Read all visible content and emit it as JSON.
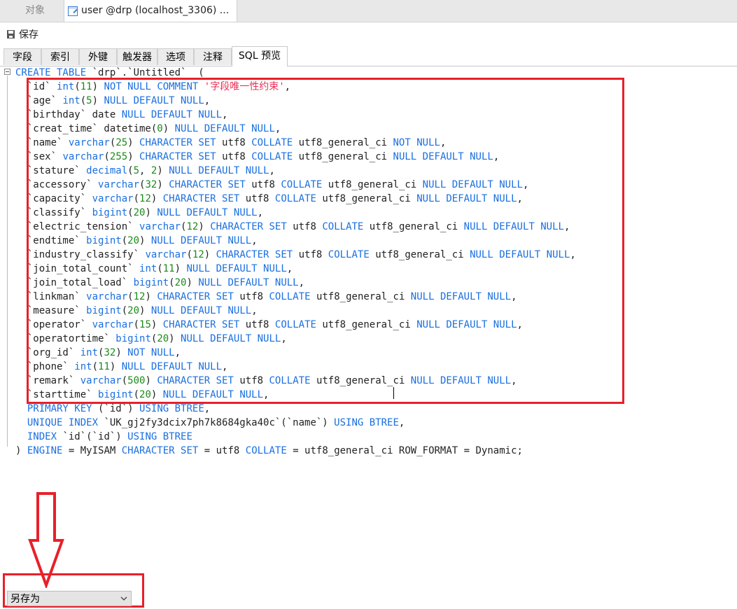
{
  "doc_tabs": {
    "objects_label": "对象",
    "active_label": "user @drp (localhost_3306) ..."
  },
  "toolbar": {
    "save_label": "保存"
  },
  "designer_tabs": [
    "字段",
    "索引",
    "外键",
    "触发器",
    "选项",
    "注释",
    "SQL 预览"
  ],
  "sql_lines": [
    [
      [
        "kw",
        "CREATE TABLE "
      ],
      [
        "txt",
        "`drp`.`Untitled`  ("
      ]
    ],
    [
      [
        "txt",
        "  `id` "
      ],
      [
        "kw",
        "int"
      ],
      [
        "txt",
        "("
      ],
      [
        "num",
        "11"
      ],
      [
        "txt",
        ") "
      ],
      [
        "kw",
        "NOT NULL COMMENT "
      ],
      [
        "str",
        "'字段唯一性约束'"
      ],
      [
        "txt",
        ","
      ]
    ],
    [
      [
        "txt",
        "  `age` "
      ],
      [
        "kw",
        "int"
      ],
      [
        "txt",
        "("
      ],
      [
        "num",
        "5"
      ],
      [
        "txt",
        ") "
      ],
      [
        "kw",
        "NULL DEFAULT NULL"
      ],
      [
        "txt",
        ","
      ]
    ],
    [
      [
        "txt",
        "  `birthday` date "
      ],
      [
        "kw",
        "NULL DEFAULT NULL"
      ],
      [
        "txt",
        ","
      ]
    ],
    [
      [
        "txt",
        "  `creat_time` datetime("
      ],
      [
        "num",
        "0"
      ],
      [
        "txt",
        ") "
      ],
      [
        "kw",
        "NULL DEFAULT NULL"
      ],
      [
        "txt",
        ","
      ]
    ],
    [
      [
        "txt",
        "  `name` "
      ],
      [
        "kw",
        "varchar"
      ],
      [
        "txt",
        "("
      ],
      [
        "num",
        "25"
      ],
      [
        "txt",
        ") "
      ],
      [
        "kw",
        "CHARACTER SET "
      ],
      [
        "txt",
        "utf8 "
      ],
      [
        "kw",
        "COLLATE "
      ],
      [
        "txt",
        "utf8_general_ci "
      ],
      [
        "kw",
        "NOT NULL"
      ],
      [
        "txt",
        ","
      ]
    ],
    [
      [
        "txt",
        "  `sex` "
      ],
      [
        "kw",
        "varchar"
      ],
      [
        "txt",
        "("
      ],
      [
        "num",
        "255"
      ],
      [
        "txt",
        ") "
      ],
      [
        "kw",
        "CHARACTER SET "
      ],
      [
        "txt",
        "utf8 "
      ],
      [
        "kw",
        "COLLATE "
      ],
      [
        "txt",
        "utf8_general_ci "
      ],
      [
        "kw",
        "NULL DEFAULT NULL"
      ],
      [
        "txt",
        ","
      ]
    ],
    [
      [
        "txt",
        "  `stature` "
      ],
      [
        "kw",
        "decimal"
      ],
      [
        "txt",
        "("
      ],
      [
        "num",
        "5"
      ],
      [
        "txt",
        ", "
      ],
      [
        "num",
        "2"
      ],
      [
        "txt",
        ") "
      ],
      [
        "kw",
        "NULL DEFAULT NULL"
      ],
      [
        "txt",
        ","
      ]
    ],
    [
      [
        "txt",
        "  `accessory` "
      ],
      [
        "kw",
        "varchar"
      ],
      [
        "txt",
        "("
      ],
      [
        "num",
        "32"
      ],
      [
        "txt",
        ") "
      ],
      [
        "kw",
        "CHARACTER SET "
      ],
      [
        "txt",
        "utf8 "
      ],
      [
        "kw",
        "COLLATE "
      ],
      [
        "txt",
        "utf8_general_ci "
      ],
      [
        "kw",
        "NULL DEFAULT NULL"
      ],
      [
        "txt",
        ","
      ]
    ],
    [
      [
        "txt",
        "  `capacity` "
      ],
      [
        "kw",
        "varchar"
      ],
      [
        "txt",
        "("
      ],
      [
        "num",
        "12"
      ],
      [
        "txt",
        ") "
      ],
      [
        "kw",
        "CHARACTER SET "
      ],
      [
        "txt",
        "utf8 "
      ],
      [
        "kw",
        "COLLATE "
      ],
      [
        "txt",
        "utf8_general_ci "
      ],
      [
        "kw",
        "NULL DEFAULT NULL"
      ],
      [
        "txt",
        ","
      ]
    ],
    [
      [
        "txt",
        "  `classify` "
      ],
      [
        "kw",
        "bigint"
      ],
      [
        "txt",
        "("
      ],
      [
        "num",
        "20"
      ],
      [
        "txt",
        ") "
      ],
      [
        "kw",
        "NULL DEFAULT NULL"
      ],
      [
        "txt",
        ","
      ]
    ],
    [
      [
        "txt",
        "  `electric_tension` "
      ],
      [
        "kw",
        "varchar"
      ],
      [
        "txt",
        "("
      ],
      [
        "num",
        "12"
      ],
      [
        "txt",
        ") "
      ],
      [
        "kw",
        "CHARACTER SET "
      ],
      [
        "txt",
        "utf8 "
      ],
      [
        "kw",
        "COLLATE "
      ],
      [
        "txt",
        "utf8_general_ci "
      ],
      [
        "kw",
        "NULL DEFAULT NULL"
      ],
      [
        "txt",
        ","
      ]
    ],
    [
      [
        "txt",
        "  `endtime` "
      ],
      [
        "kw",
        "bigint"
      ],
      [
        "txt",
        "("
      ],
      [
        "num",
        "20"
      ],
      [
        "txt",
        ") "
      ],
      [
        "kw",
        "NULL DEFAULT NULL"
      ],
      [
        "txt",
        ","
      ]
    ],
    [
      [
        "txt",
        "  `industry_classify` "
      ],
      [
        "kw",
        "varchar"
      ],
      [
        "txt",
        "("
      ],
      [
        "num",
        "12"
      ],
      [
        "txt",
        ") "
      ],
      [
        "kw",
        "CHARACTER SET "
      ],
      [
        "txt",
        "utf8 "
      ],
      [
        "kw",
        "COLLATE "
      ],
      [
        "txt",
        "utf8_general_ci "
      ],
      [
        "kw",
        "NULL DEFAULT NULL"
      ],
      [
        "txt",
        ","
      ]
    ],
    [
      [
        "txt",
        "  `join_total_count` "
      ],
      [
        "kw",
        "int"
      ],
      [
        "txt",
        "("
      ],
      [
        "num",
        "11"
      ],
      [
        "txt",
        ") "
      ],
      [
        "kw",
        "NULL DEFAULT NULL"
      ],
      [
        "txt",
        ","
      ]
    ],
    [
      [
        "txt",
        "  `join_total_load` "
      ],
      [
        "kw",
        "bigint"
      ],
      [
        "txt",
        "("
      ],
      [
        "num",
        "20"
      ],
      [
        "txt",
        ") "
      ],
      [
        "kw",
        "NULL DEFAULT NULL"
      ],
      [
        "txt",
        ","
      ]
    ],
    [
      [
        "txt",
        "  `linkman` "
      ],
      [
        "kw",
        "varchar"
      ],
      [
        "txt",
        "("
      ],
      [
        "num",
        "12"
      ],
      [
        "txt",
        ") "
      ],
      [
        "kw",
        "CHARACTER SET "
      ],
      [
        "txt",
        "utf8 "
      ],
      [
        "kw",
        "COLLATE "
      ],
      [
        "txt",
        "utf8_general_ci "
      ],
      [
        "kw",
        "NULL DEFAULT NULL"
      ],
      [
        "txt",
        ","
      ]
    ],
    [
      [
        "txt",
        "  `measure` "
      ],
      [
        "kw",
        "bigint"
      ],
      [
        "txt",
        "("
      ],
      [
        "num",
        "20"
      ],
      [
        "txt",
        ") "
      ],
      [
        "kw",
        "NULL DEFAULT NULL"
      ],
      [
        "txt",
        ","
      ]
    ],
    [
      [
        "txt",
        "  `operator` "
      ],
      [
        "kw",
        "varchar"
      ],
      [
        "txt",
        "("
      ],
      [
        "num",
        "15"
      ],
      [
        "txt",
        ") "
      ],
      [
        "kw",
        "CHARACTER SET "
      ],
      [
        "txt",
        "utf8 "
      ],
      [
        "kw",
        "COLLATE "
      ],
      [
        "txt",
        "utf8_general_ci "
      ],
      [
        "kw",
        "NULL DEFAULT NULL"
      ],
      [
        "txt",
        ","
      ]
    ],
    [
      [
        "txt",
        "  `operatortime` "
      ],
      [
        "kw",
        "bigint"
      ],
      [
        "txt",
        "("
      ],
      [
        "num",
        "20"
      ],
      [
        "txt",
        ") "
      ],
      [
        "kw",
        "NULL DEFAULT NULL"
      ],
      [
        "txt",
        ","
      ]
    ],
    [
      [
        "txt",
        "  `org_id` "
      ],
      [
        "kw",
        "int"
      ],
      [
        "txt",
        "("
      ],
      [
        "num",
        "32"
      ],
      [
        "txt",
        ") "
      ],
      [
        "kw",
        "NOT NULL"
      ],
      [
        "txt",
        ","
      ]
    ],
    [
      [
        "txt",
        "  `phone` "
      ],
      [
        "kw",
        "int"
      ],
      [
        "txt",
        "("
      ],
      [
        "num",
        "11"
      ],
      [
        "txt",
        ") "
      ],
      [
        "kw",
        "NULL DEFAULT NULL"
      ],
      [
        "txt",
        ","
      ]
    ],
    [
      [
        "txt",
        "  `remark` "
      ],
      [
        "kw",
        "varchar"
      ],
      [
        "txt",
        "("
      ],
      [
        "num",
        "500"
      ],
      [
        "txt",
        ") "
      ],
      [
        "kw",
        "CHARACTER SET "
      ],
      [
        "txt",
        "utf8 "
      ],
      [
        "kw",
        "COLLATE "
      ],
      [
        "txt",
        "utf8_general_ci "
      ],
      [
        "kw",
        "NULL DEFAULT NULL"
      ],
      [
        "txt",
        ","
      ]
    ],
    [
      [
        "txt",
        "  `starttime` "
      ],
      [
        "kw",
        "bigint"
      ],
      [
        "txt",
        "("
      ],
      [
        "num",
        "20"
      ],
      [
        "txt",
        ") "
      ],
      [
        "kw",
        "NULL DEFAULT NULL"
      ],
      [
        "txt",
        ","
      ]
    ],
    [
      [
        "txt",
        "  "
      ],
      [
        "kw",
        "PRIMARY KEY "
      ],
      [
        "txt",
        "(`id`) "
      ],
      [
        "kw",
        "USING BTREE"
      ],
      [
        "txt",
        ","
      ]
    ],
    [
      [
        "txt",
        "  "
      ],
      [
        "kw",
        "UNIQUE INDEX "
      ],
      [
        "txt",
        "`UK_gj2fy3dcix7ph7k8684gka40c`(`name`) "
      ],
      [
        "kw",
        "USING BTREE"
      ],
      [
        "txt",
        ","
      ]
    ],
    [
      [
        "txt",
        "  "
      ],
      [
        "kw",
        "INDEX "
      ],
      [
        "txt",
        "`id`(`id`) "
      ],
      [
        "kw",
        "USING BTREE"
      ]
    ],
    [
      [
        "txt",
        ") "
      ],
      [
        "kw",
        "ENGINE "
      ],
      [
        "txt",
        "= MyISAM "
      ],
      [
        "kw",
        "CHARACTER SET "
      ],
      [
        "txt",
        "= utf8 "
      ],
      [
        "kw",
        "COLLATE "
      ],
      [
        "txt",
        "= utf8_general_ci ROW_FORMAT = Dynamic;"
      ]
    ]
  ],
  "save_as": {
    "label": "另存为"
  },
  "colors": {
    "keyword": "#1a6fe0",
    "number": "#1a8a1a",
    "string": "#e8325a",
    "annotation": "#e8202a"
  }
}
